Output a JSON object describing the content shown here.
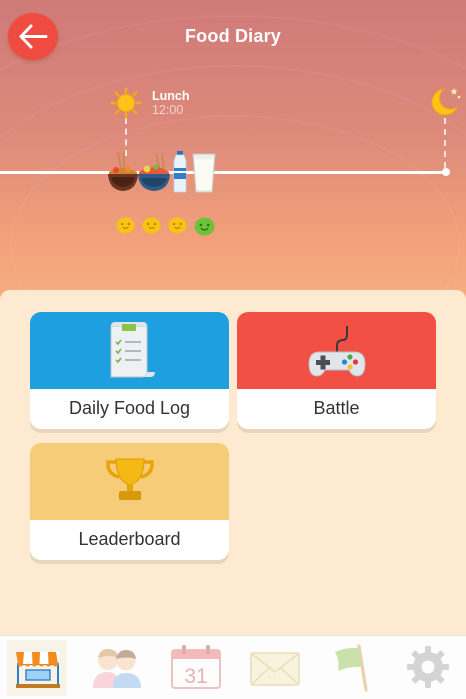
{
  "header": {
    "title": "Food Diary",
    "back_icon": "back-arrow-icon"
  },
  "timeline": {
    "meal": {
      "label": "Lunch",
      "time": "12:00",
      "icon": "sun-icon"
    },
    "end_icon": "moon-icon",
    "foods": [
      "noodle-bowl-icon",
      "ramen-bowl-icon",
      "water-bottle-icon",
      "milk-glass-icon"
    ],
    "moods": [
      "face-yellow-icon",
      "face-yellow-icon",
      "face-yellow-icon",
      "face-green-icon"
    ]
  },
  "cards": {
    "daily_food_log": {
      "label": "Daily Food Log",
      "color": "#1e9fe0",
      "icon": "receipt-icon"
    },
    "battle": {
      "label": "Battle",
      "color": "#f25045",
      "icon": "gamepad-icon"
    },
    "leaderboard": {
      "label": "Leaderboard",
      "color": "#f7cc78",
      "icon": "trophy-icon"
    }
  },
  "tabbar": {
    "tabs": [
      {
        "name": "shop",
        "icon": "shop-icon",
        "active": true
      },
      {
        "name": "friends",
        "icon": "friends-icon"
      },
      {
        "name": "calendar",
        "icon": "calendar-icon",
        "day": "31"
      },
      {
        "name": "messages",
        "icon": "mail-icon"
      },
      {
        "name": "goals",
        "icon": "flag-icon"
      },
      {
        "name": "settings",
        "icon": "gear-icon"
      }
    ]
  }
}
